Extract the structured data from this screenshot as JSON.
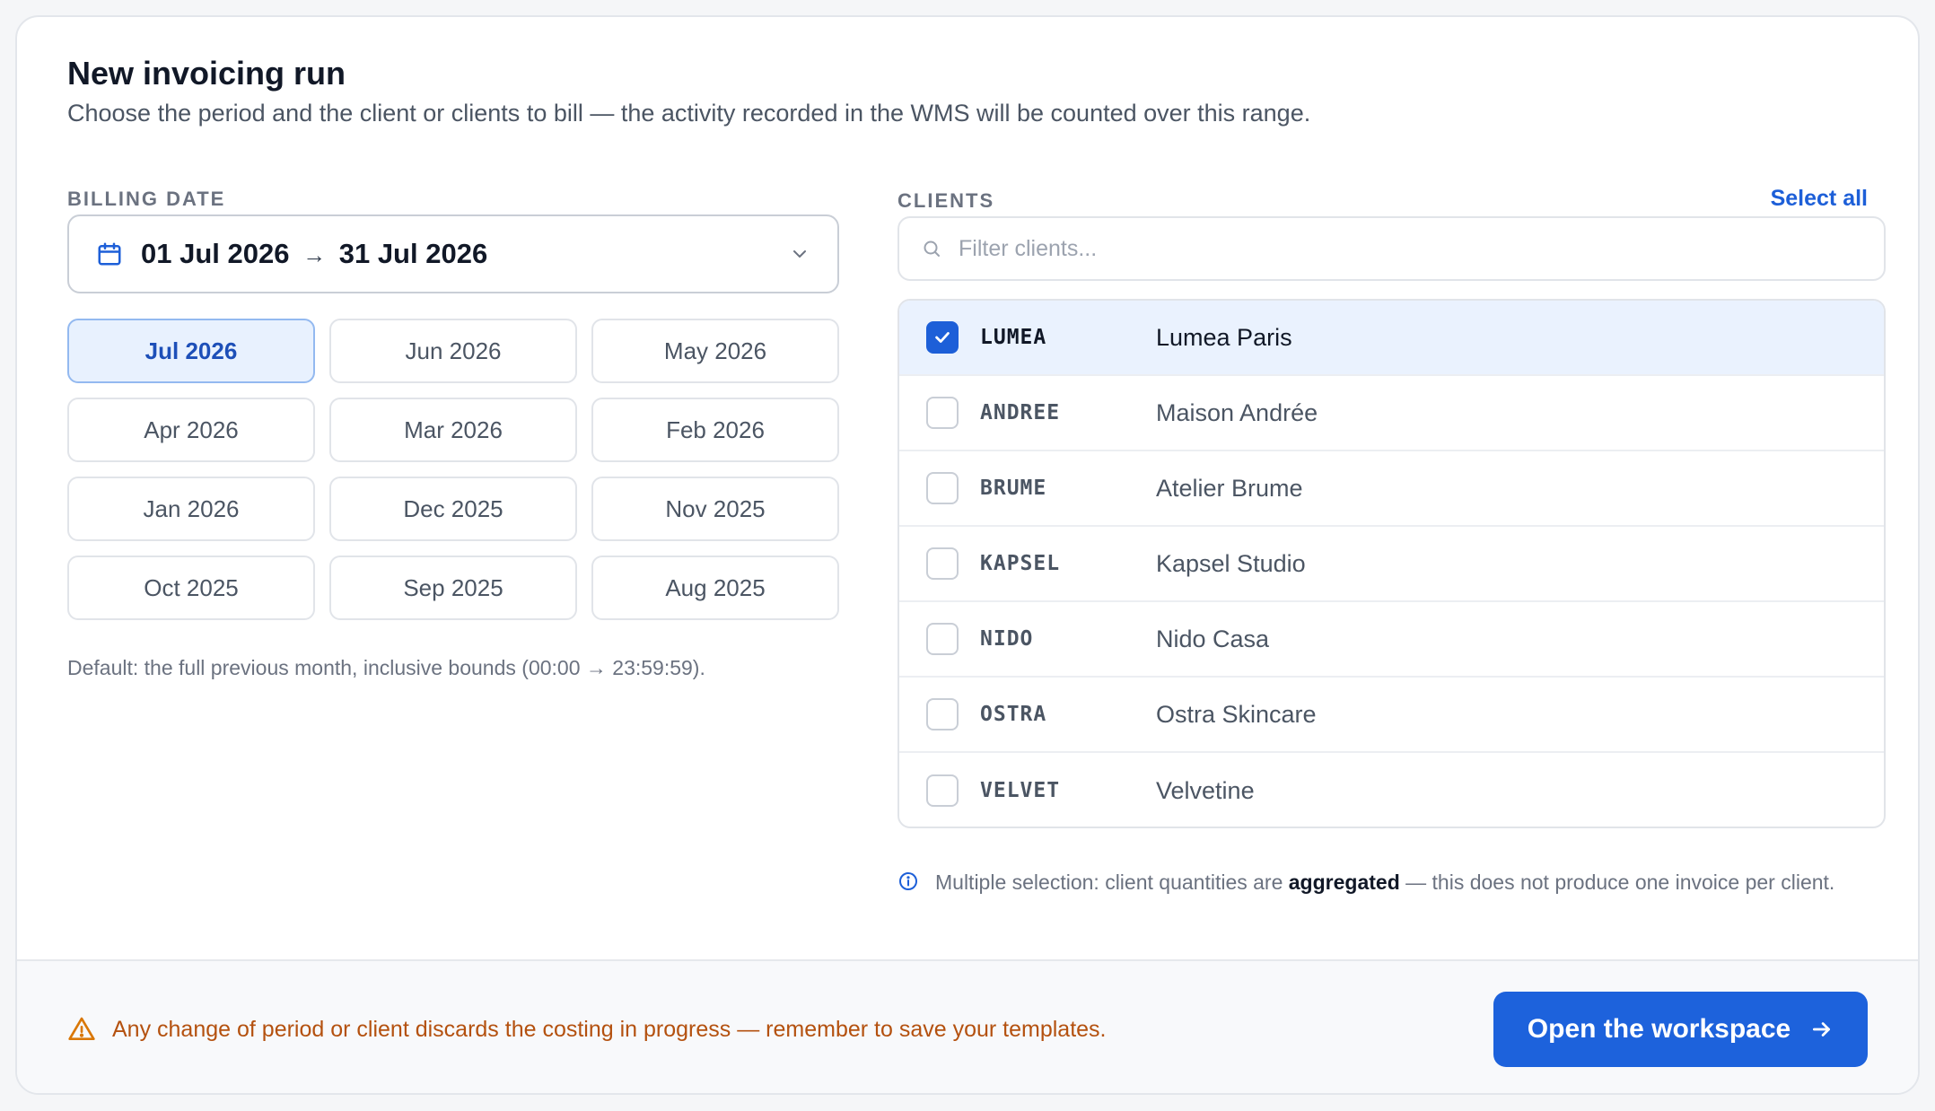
{
  "header": {
    "title": "New invoicing run",
    "subtitle": "Choose the period and the client or clients to bill — the activity recorded in the WMS will be counted over this range."
  },
  "billing": {
    "label": "BILLING DATE",
    "range_start": "01 Jul 2026",
    "range_arrow": "→",
    "range_end": "31 Jul 2026",
    "months": [
      "Jul 2026",
      "Jun 2026",
      "May 2026",
      "Apr 2026",
      "Mar 2026",
      "Feb 2026",
      "Jan 2026",
      "Dec 2025",
      "Nov 2025",
      "Oct 2025",
      "Sep 2025",
      "Aug 2025"
    ],
    "selected_month": "Jul 2026",
    "default_note": "Default: the full previous month, inclusive bounds (00:00 → 23:59:59)."
  },
  "clients": {
    "label": "CLIENTS",
    "select_all": "Select all",
    "filter_placeholder": "Filter clients...",
    "list": [
      {
        "code": "LUMEA",
        "name": "Lumea Paris",
        "selected": true
      },
      {
        "code": "ANDREE",
        "name": "Maison Andrée",
        "selected": false
      },
      {
        "code": "BRUME",
        "name": "Atelier Brume",
        "selected": false
      },
      {
        "code": "KAPSEL",
        "name": "Kapsel Studio",
        "selected": false
      },
      {
        "code": "NIDO",
        "name": "Nido Casa",
        "selected": false
      },
      {
        "code": "OSTRA",
        "name": "Ostra Skincare",
        "selected": false
      },
      {
        "code": "VELVET",
        "name": "Velvetine",
        "selected": false
      }
    ],
    "info_prefix": "Multiple selection: client quantities are",
    "info_bold": "aggregated",
    "info_suffix": "— this does not produce one invoice per client."
  },
  "footer": {
    "warning": "Any change of period or client discards the costing in progress — remember to save your templates.",
    "cta_label": "Open the workspace"
  },
  "colors": {
    "accent": "#1d62dc",
    "warning": "#b4510f",
    "selected_bg": "#eaf2fe"
  },
  "icons": {
    "date": "calendar-icon",
    "dropdown": "chevron-down-icon",
    "filter": "search-icon",
    "checkbox": "check-icon",
    "info": "info-icon",
    "warning": "warning-triangle-icon",
    "cta": "arrow-right-icon"
  }
}
